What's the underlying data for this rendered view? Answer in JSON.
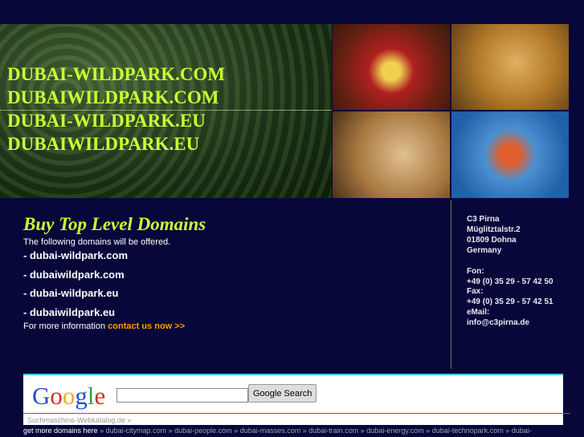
{
  "banner": {
    "domains": [
      "DUBAI-WILDPARK.COM",
      "DUBAIWILDPARK.COM",
      "DUBAI-WILDPARK.EU",
      "DUBAIWILDPARK.EU"
    ]
  },
  "main": {
    "title": "Buy Top Level Domains",
    "intro": "The following domains will be offered.",
    "domains": [
      "- dubai-wildpark.com",
      "- dubaiwildpark.com",
      "- dubai-wildpark.eu",
      "- dubaiwildpark.eu"
    ],
    "more_text": "For more information",
    "contact_link": "contact us now >>"
  },
  "address": [
    "C3 Pirna",
    "Müglitztalstr.2",
    "01809 Dohna",
    "Germany",
    "",
    "Fon:",
    "+49 (0) 35 29 - 57 42 50",
    "Fax:",
    "+49 (0) 35 29 - 57 42 51",
    "eMail:",
    "info@c3pirna.de"
  ],
  "search": {
    "logo": "Google",
    "button": "Google Search",
    "value": "",
    "katalog": "Suchmaschine-Webkatalog.de »"
  },
  "footer": {
    "label": "get more domains here",
    "links": [
      "dubai-citymap.com",
      "dubai-people.com",
      "dubai-masses.com",
      "dubai-train.com",
      "dubai-energy.com",
      "dubai-technopark.com",
      "dubai-"
    ]
  }
}
